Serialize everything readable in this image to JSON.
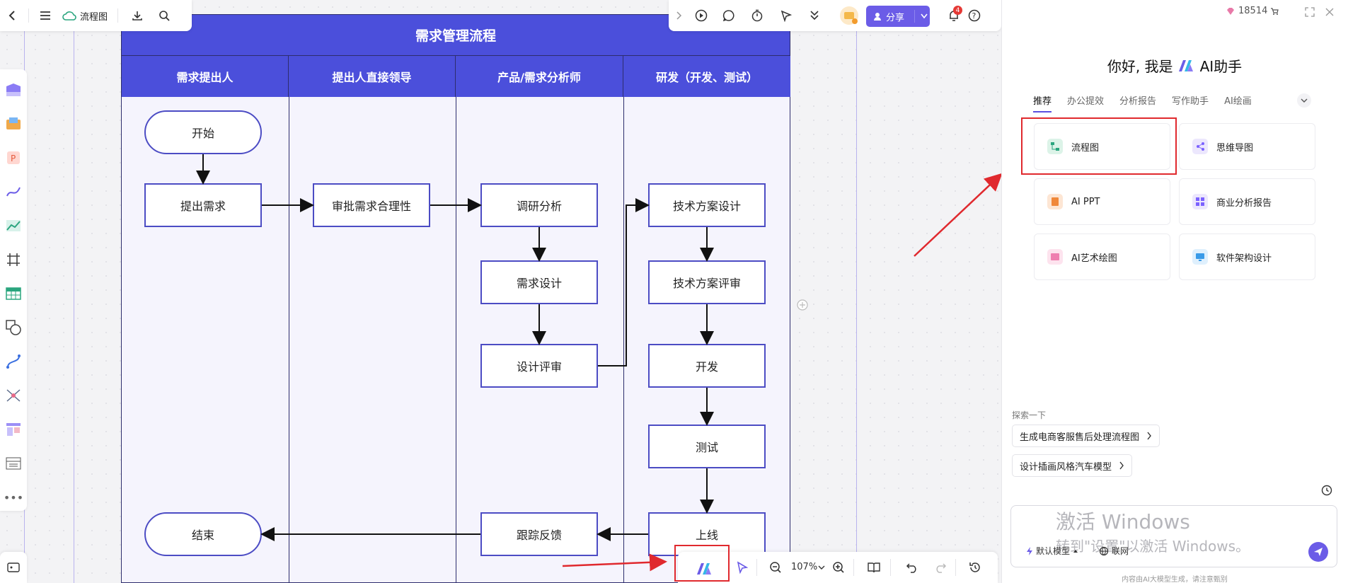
{
  "toolbar_left": {
    "doc_title": "流程图"
  },
  "toolbar_right": {
    "share_label": "分享",
    "notif_count": "4"
  },
  "diagram": {
    "title": "需求管理流程",
    "lanes": [
      "需求提出人",
      "提出人直接领导",
      "产品/需求分析师",
      "研发（开发、测试）"
    ],
    "nodes": {
      "start": "开始",
      "submit": "提出需求",
      "approve": "审批需求合理性",
      "research": "调研分析",
      "design": "需求设计",
      "review": "设计评审",
      "tech_design": "技术方案设计",
      "tech_review": "技术方案评审",
      "develop": "开发",
      "test": "测试",
      "release": "上线",
      "feedback": "跟踪反馈",
      "end": "结束"
    }
  },
  "bottom_bar": {
    "zoom": "107%"
  },
  "ai_panel": {
    "credits": "18514",
    "greeting_prefix": "你好, 我是",
    "greeting_suffix": "AI助手",
    "tabs": [
      "推荐",
      "办公提效",
      "分析报告",
      "写作助手",
      "AI绘画"
    ],
    "cards": [
      "流程图",
      "思维导图",
      "AI PPT",
      "商业分析报告",
      "AI艺术绘图",
      "软件架构设计"
    ],
    "explore_label": "探索一下",
    "suggestions": [
      "生成电商客服售后处理流程图",
      "设计插画风格汽车模型"
    ],
    "watermark_line1": "激活 Windows",
    "watermark_line2": "转到\"设置\"以激活 Windows。",
    "model_label": "默认模型",
    "network_label": "联网",
    "disclaimer": "内容由AI大模型生成，请注意甄别"
  },
  "colors": {
    "lane_header": "#4b4fdb",
    "node_border": "#4c4cc4",
    "accent": "#6b5ce7",
    "highlight": "#e0292e"
  }
}
